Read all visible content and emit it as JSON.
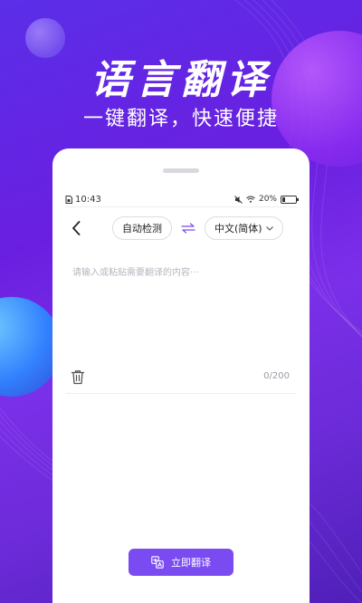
{
  "promo": {
    "title": "语言翻译",
    "subtitle": "一键翻译，快速便捷"
  },
  "status_bar": {
    "time": "10:43",
    "battery_percent": "20%"
  },
  "toolbar": {
    "source_language": "自动检测",
    "target_language": "中文(简体)"
  },
  "input": {
    "placeholder": "请输入或粘贴需要翻译的内容···",
    "value": "",
    "counter": "0/200"
  },
  "action": {
    "translate_label": "立即翻译"
  },
  "icons": [
    "back-arrow-icon",
    "swap-icon",
    "chevron-down-icon",
    "trash-icon",
    "translate-icon",
    "wifi-icon",
    "battery-icon",
    "mute-icon",
    "sim-icon"
  ],
  "colors": {
    "accent": "#7a4bf1",
    "background_purple": "#6a1fe0"
  }
}
